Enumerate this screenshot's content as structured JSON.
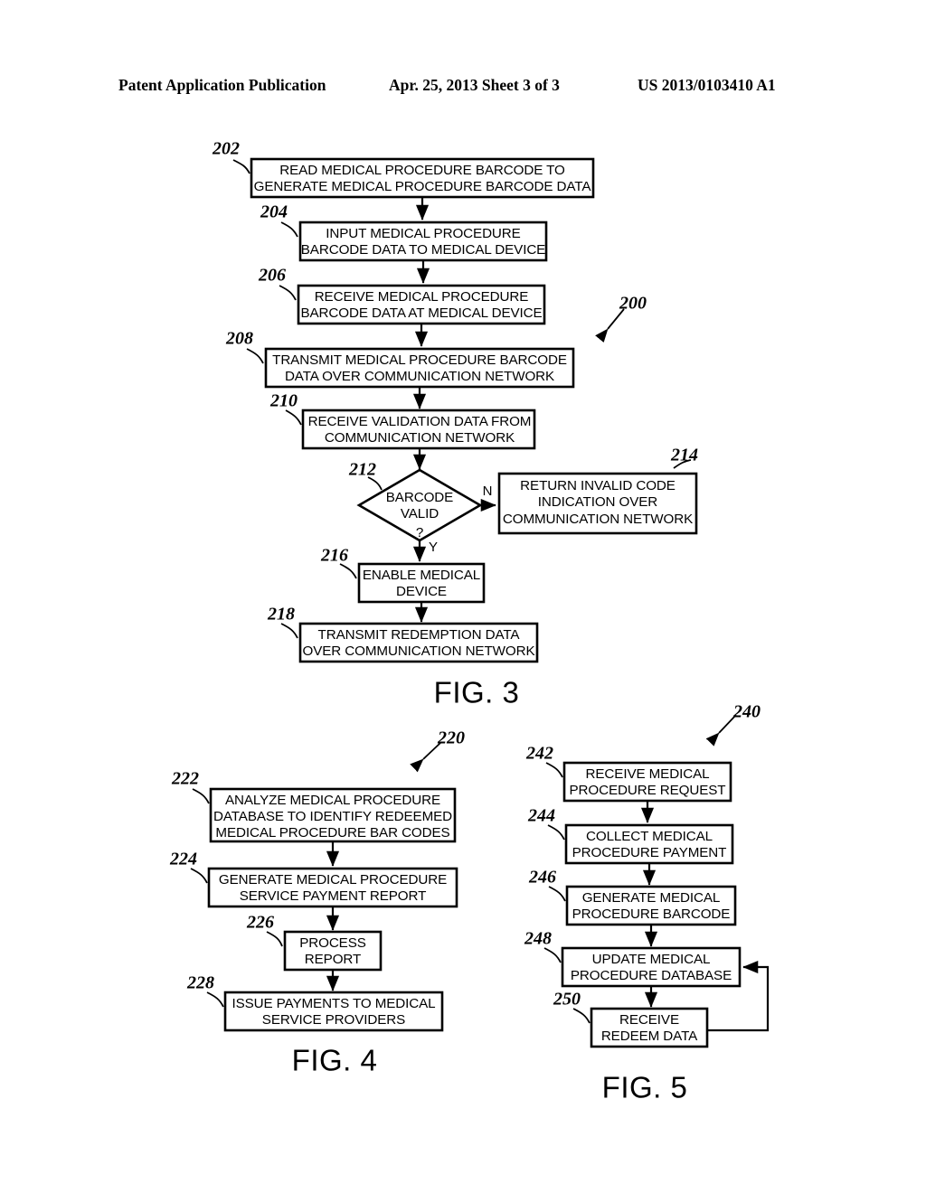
{
  "header": {
    "left": "Patent Application Publication",
    "middle": "Apr. 25, 2013  Sheet 3 of 3",
    "right": "US 2013/0103410 A1"
  },
  "figures": [
    {
      "id": "fig3",
      "label": "FIG. 3",
      "ref": "200",
      "steps": [
        {
          "ref": "202",
          "lines": [
            "READ MEDICAL PROCEDURE BARCODE TO",
            "GENERATE MEDICAL PROCEDURE BARCODE DATA"
          ]
        },
        {
          "ref": "204",
          "lines": [
            "INPUT MEDICAL PROCEDURE",
            "BARCODE DATA TO MEDICAL DEVICE"
          ]
        },
        {
          "ref": "206",
          "lines": [
            "RECEIVE MEDICAL PROCEDURE",
            "BARCODE DATA AT MEDICAL DEVICE"
          ]
        },
        {
          "ref": "208",
          "lines": [
            "TRANSMIT MEDICAL PROCEDURE BARCODE",
            "DATA OVER COMMUNICATION NETWORK"
          ]
        },
        {
          "ref": "210",
          "lines": [
            "RECEIVE VALIDATION DATA FROM",
            "COMMUNICATION NETWORK"
          ]
        },
        {
          "ref": "212",
          "lines": [
            "BARCODE",
            "VALID",
            "?"
          ],
          "shape": "decision"
        },
        {
          "ref": "214",
          "lines": [
            "RETURN INVALID CODE",
            "INDICATION OVER",
            "COMMUNICATION NETWORK"
          ]
        },
        {
          "ref": "216",
          "lines": [
            "ENABLE MEDICAL",
            "DEVICE"
          ]
        },
        {
          "ref": "218",
          "lines": [
            "TRANSMIT REDEMPTION DATA",
            "OVER COMMUNICATION NETWORK"
          ]
        }
      ],
      "branch_labels": {
        "no": "N",
        "yes": "Y"
      }
    },
    {
      "id": "fig4",
      "label": "FIG. 4",
      "ref": "220",
      "steps": [
        {
          "ref": "222",
          "lines": [
            "ANALYZE MEDICAL PROCEDURE",
            "DATABASE TO IDENTIFY REDEEMED",
            "MEDICAL PROCEDURE BAR CODES"
          ]
        },
        {
          "ref": "224",
          "lines": [
            "GENERATE MEDICAL PROCEDURE",
            "SERVICE PAYMENT REPORT"
          ]
        },
        {
          "ref": "226",
          "lines": [
            "PROCESS",
            "REPORT"
          ]
        },
        {
          "ref": "228",
          "lines": [
            "ISSUE PAYMENTS TO MEDICAL",
            "SERVICE PROVIDERS"
          ]
        }
      ]
    },
    {
      "id": "fig5",
      "label": "FIG. 5",
      "ref": "240",
      "steps": [
        {
          "ref": "242",
          "lines": [
            "RECEIVE MEDICAL",
            "PROCEDURE REQUEST"
          ]
        },
        {
          "ref": "244",
          "lines": [
            "COLLECT MEDICAL",
            "PROCEDURE PAYMENT"
          ]
        },
        {
          "ref": "246",
          "lines": [
            "GENERATE MEDICAL",
            "PROCEDURE BARCODE"
          ]
        },
        {
          "ref": "248",
          "lines": [
            "UPDATE MEDICAL",
            "PROCEDURE DATABASE"
          ]
        },
        {
          "ref": "250",
          "lines": [
            "RECEIVE",
            "REDEEM DATA"
          ]
        }
      ]
    }
  ],
  "colors": {
    "ink": "#000000",
    "paper": "#ffffff"
  }
}
